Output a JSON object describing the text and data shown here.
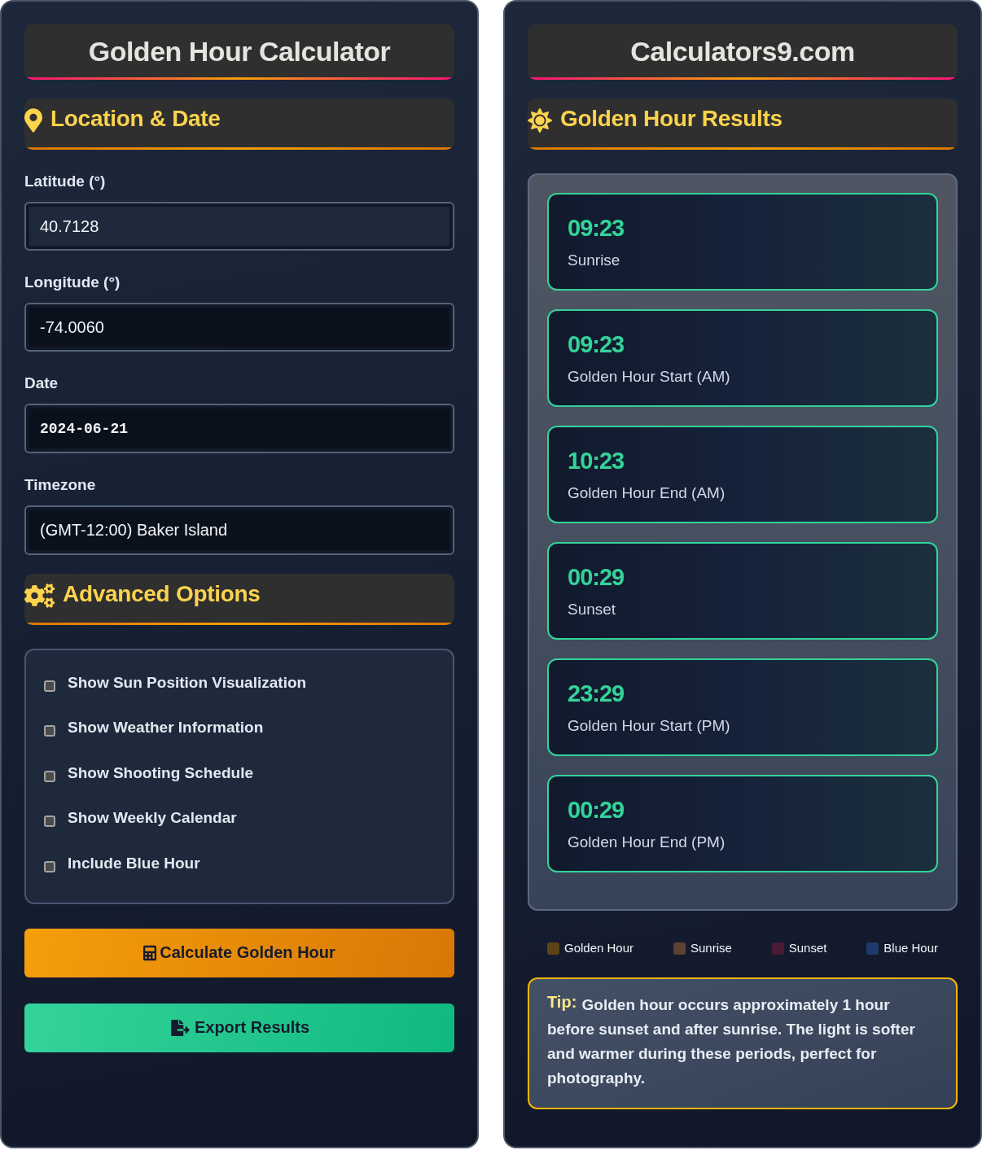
{
  "left_panel": {
    "title": "Golden Hour Calculator",
    "location_section": {
      "heading": "Location & Date",
      "fields": [
        {
          "label": "Latitude (°)",
          "value": "40.7128",
          "kind": "number",
          "focused": true
        },
        {
          "label": "Longitude (°)",
          "value": "-74.0060",
          "kind": "number",
          "focused": false
        },
        {
          "label": "Date",
          "value": "2024-06-21",
          "kind": "date",
          "focused": false
        },
        {
          "label": "Timezone",
          "value": "(GMT-12:00) Baker Island",
          "kind": "select",
          "focused": false
        }
      ]
    },
    "advanced_section": {
      "heading": "Advanced Options",
      "options": [
        {
          "label": "Show Sun Position Visualization",
          "checked": false
        },
        {
          "label": "Show Weather Information",
          "checked": false
        },
        {
          "label": "Show Shooting Schedule",
          "checked": false
        },
        {
          "label": "Show Weekly Calendar",
          "checked": false
        },
        {
          "label": "Include Blue Hour",
          "checked": false
        }
      ]
    },
    "buttons": [
      {
        "label": "Calculate Golden Hour",
        "kind": "calculate"
      },
      {
        "label": "Export Results",
        "kind": "export"
      }
    ]
  },
  "right_panel": {
    "title": "Calculators9.com",
    "results_section": {
      "heading": "Golden Hour Results",
      "results": [
        {
          "time": "09:23",
          "label": "Sunrise"
        },
        {
          "time": "09:23",
          "label": "Golden Hour Start (AM)"
        },
        {
          "time": "10:23",
          "label": "Golden Hour End (AM)"
        },
        {
          "time": "00:29",
          "label": "Sunset"
        },
        {
          "time": "23:29",
          "label": "Golden Hour Start (PM)"
        },
        {
          "time": "00:29",
          "label": "Golden Hour End (PM)"
        }
      ]
    },
    "legend": [
      {
        "label": "Golden Hour",
        "color": "#5c4318"
      },
      {
        "label": "Sunrise",
        "color": "#5e4234"
      },
      {
        "label": "Sunset",
        "color": "#4a1a36"
      },
      {
        "label": "Blue Hour",
        "color": "#1e3a6a"
      }
    ],
    "tip": {
      "text": "$^{Tip:}$ Golden hour occurs approximately 1 hour before sunset and after sunrise. The light is softer and warmer during these periods, perfect for photography."
    }
  }
}
